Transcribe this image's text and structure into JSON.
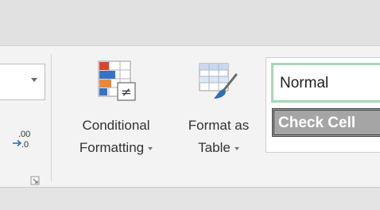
{
  "ribbon": {
    "number_group": {
      "decimal_icon": "decrease-decimal-icon",
      "decrease_decimal_top": ".00",
      "decrease_decimal_bottom": ".0"
    },
    "styles_group": {
      "conditional_formatting": {
        "line1": "Conditional",
        "line2": "Formatting",
        "icon": "conditional-formatting-icon"
      },
      "format_as_table": {
        "line1": "Format as",
        "line2": "Table",
        "icon": "format-as-table-icon"
      },
      "cell_styles": {
        "normal": "Normal",
        "check_cell": "Check Cell"
      }
    }
  },
  "colors": {
    "ribbon_bg": "#f3f3f3",
    "normal_style_border": "#a8d8b9",
    "check_cell_bg": "#a5a5a5",
    "bar_red": "#d9452b",
    "bar_blue": "#3574c4",
    "bar_orange": "#e8893a",
    "brush_blue": "#2b6fb8"
  }
}
